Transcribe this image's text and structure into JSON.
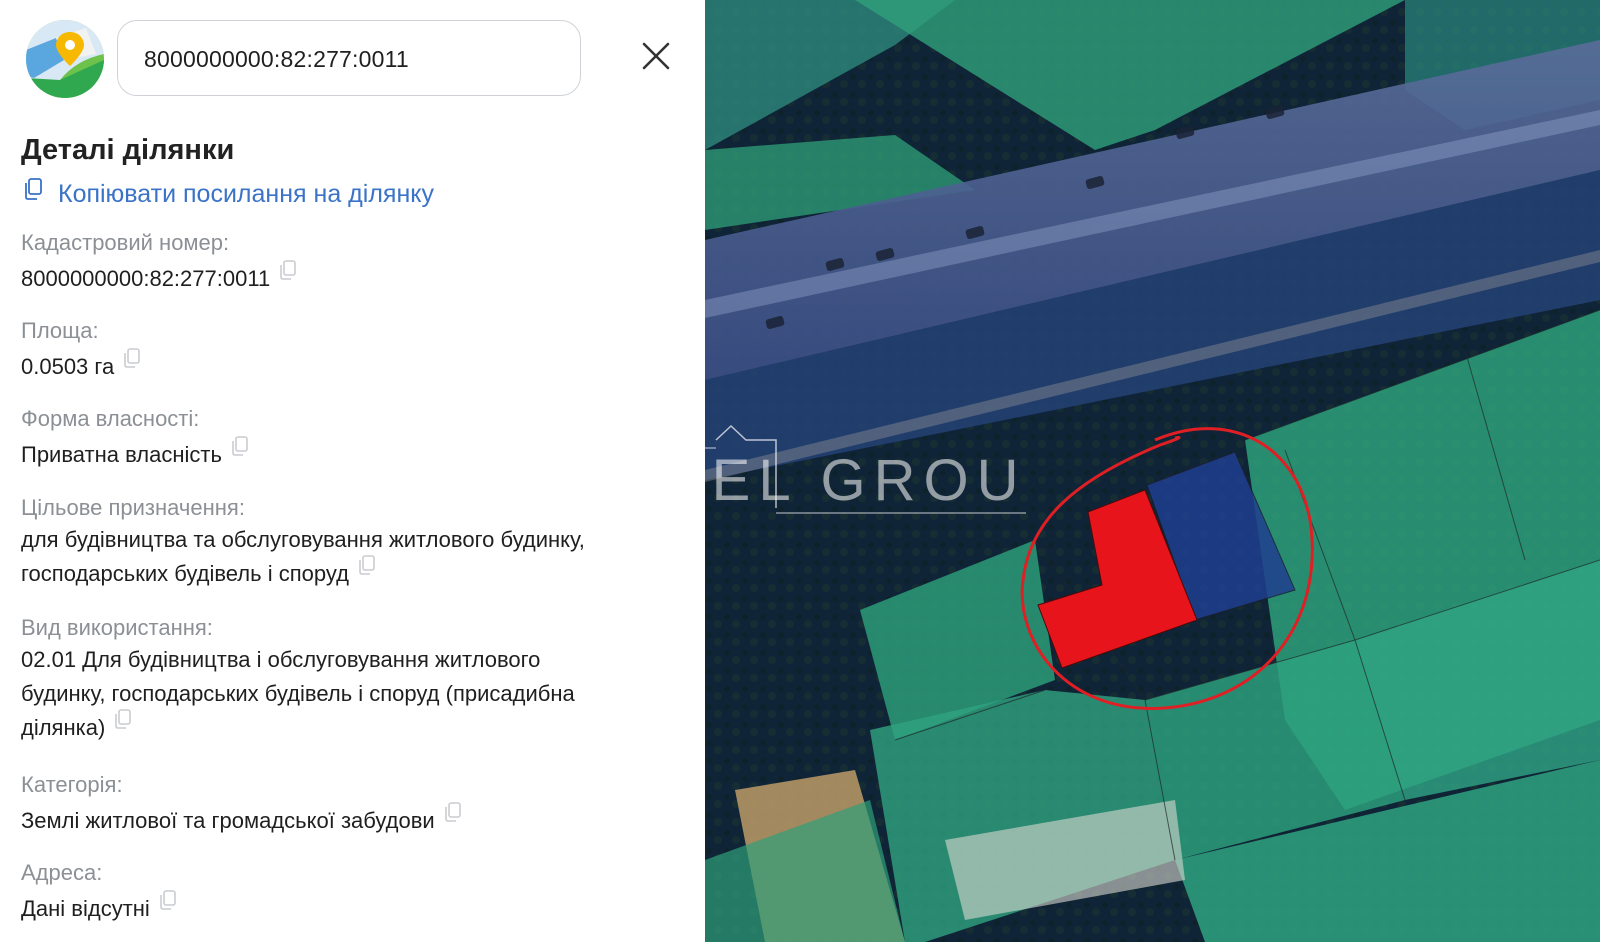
{
  "search": {
    "value": "8000000000:82:277:0011",
    "placeholder": ""
  },
  "panel": {
    "title": "Деталі ділянки",
    "copy_link_label": "Копіювати посилання на ділянку"
  },
  "fields": [
    {
      "label": "Кадастровий номер:",
      "value": "8000000000:82:277:0011"
    },
    {
      "label": "Площа:",
      "value": "0.0503 га"
    },
    {
      "label": "Форма власності:",
      "value": "Приватна власність"
    },
    {
      "label": "Цільове призначення:",
      "value_lines": [
        "для будівництва та обслуговування житлового будинку,",
        "господарських будівель і споруд"
      ]
    },
    {
      "label": "Вид використання:",
      "value_lines": [
        "02.01 Для будівництва і обслуговування житлового",
        "будинку, господарських будівель і споруд (присадибна",
        "ділянка)"
      ]
    },
    {
      "label": "Категорія:",
      "value": "Землі житлової та громадської забудови"
    },
    {
      "label": "Адреса:",
      "value": "Дані відсутні"
    }
  ],
  "watermark": {
    "text": "LEVEL GROUP"
  },
  "colors": {
    "link": "#3a73c7",
    "label_gray": "#8c9095",
    "parcel_green": "#2faa7a",
    "parcel_blue": "#1f3f8f",
    "selected_parcel": "#e8141b",
    "circle_mark": "#e01f24"
  },
  "icons": [
    "map-pin-logo-icon",
    "close-icon",
    "copy-icon"
  ]
}
